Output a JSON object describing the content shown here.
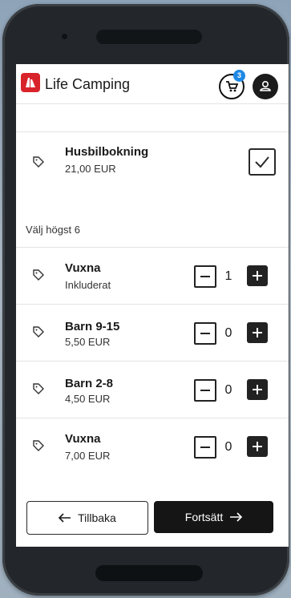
{
  "app": {
    "brand": "Life Camping",
    "cart_count": "3"
  },
  "booking": {
    "name": "Husbilbokning",
    "price": "21,00 EUR",
    "checked": true
  },
  "section_label": "Välj högst 6",
  "items": [
    {
      "name": "Vuxna",
      "price": "Inkluderat",
      "count": "1"
    },
    {
      "name": "Barn 9-15",
      "price": "5,50 EUR",
      "count": "0"
    },
    {
      "name": "Barn 2-8",
      "price": "4,50 EUR",
      "count": "0"
    },
    {
      "name": "Vuxna",
      "price": "7,00 EUR",
      "count": "0"
    }
  ],
  "buttons": {
    "back": "Tillbaka",
    "next": "Fortsätt"
  },
  "colors": {
    "brand": "#d8232a",
    "badge": "#1e88e5",
    "dark": "#151515"
  }
}
